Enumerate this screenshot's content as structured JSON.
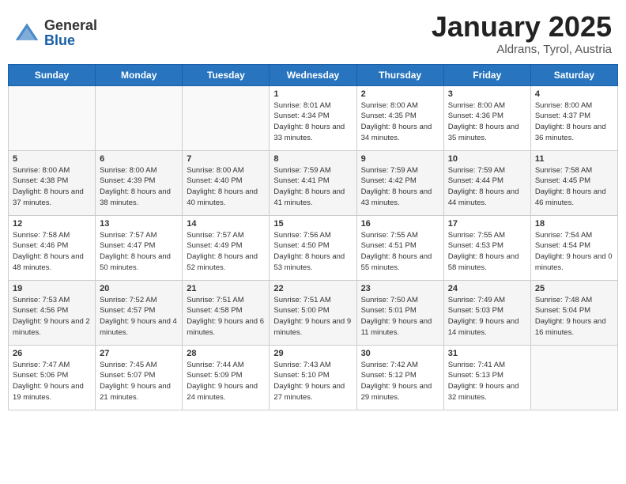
{
  "logo": {
    "general": "General",
    "blue": "Blue"
  },
  "title": "January 2025",
  "subtitle": "Aldrans, Tyrol, Austria",
  "days_of_week": [
    "Sunday",
    "Monday",
    "Tuesday",
    "Wednesday",
    "Thursday",
    "Friday",
    "Saturday"
  ],
  "weeks": [
    [
      {
        "num": "",
        "info": ""
      },
      {
        "num": "",
        "info": ""
      },
      {
        "num": "",
        "info": ""
      },
      {
        "num": "1",
        "info": "Sunrise: 8:01 AM\nSunset: 4:34 PM\nDaylight: 8 hours and 33 minutes."
      },
      {
        "num": "2",
        "info": "Sunrise: 8:00 AM\nSunset: 4:35 PM\nDaylight: 8 hours and 34 minutes."
      },
      {
        "num": "3",
        "info": "Sunrise: 8:00 AM\nSunset: 4:36 PM\nDaylight: 8 hours and 35 minutes."
      },
      {
        "num": "4",
        "info": "Sunrise: 8:00 AM\nSunset: 4:37 PM\nDaylight: 8 hours and 36 minutes."
      }
    ],
    [
      {
        "num": "5",
        "info": "Sunrise: 8:00 AM\nSunset: 4:38 PM\nDaylight: 8 hours and 37 minutes."
      },
      {
        "num": "6",
        "info": "Sunrise: 8:00 AM\nSunset: 4:39 PM\nDaylight: 8 hours and 38 minutes."
      },
      {
        "num": "7",
        "info": "Sunrise: 8:00 AM\nSunset: 4:40 PM\nDaylight: 8 hours and 40 minutes."
      },
      {
        "num": "8",
        "info": "Sunrise: 7:59 AM\nSunset: 4:41 PM\nDaylight: 8 hours and 41 minutes."
      },
      {
        "num": "9",
        "info": "Sunrise: 7:59 AM\nSunset: 4:42 PM\nDaylight: 8 hours and 43 minutes."
      },
      {
        "num": "10",
        "info": "Sunrise: 7:59 AM\nSunset: 4:44 PM\nDaylight: 8 hours and 44 minutes."
      },
      {
        "num": "11",
        "info": "Sunrise: 7:58 AM\nSunset: 4:45 PM\nDaylight: 8 hours and 46 minutes."
      }
    ],
    [
      {
        "num": "12",
        "info": "Sunrise: 7:58 AM\nSunset: 4:46 PM\nDaylight: 8 hours and 48 minutes."
      },
      {
        "num": "13",
        "info": "Sunrise: 7:57 AM\nSunset: 4:47 PM\nDaylight: 8 hours and 50 minutes."
      },
      {
        "num": "14",
        "info": "Sunrise: 7:57 AM\nSunset: 4:49 PM\nDaylight: 8 hours and 52 minutes."
      },
      {
        "num": "15",
        "info": "Sunrise: 7:56 AM\nSunset: 4:50 PM\nDaylight: 8 hours and 53 minutes."
      },
      {
        "num": "16",
        "info": "Sunrise: 7:55 AM\nSunset: 4:51 PM\nDaylight: 8 hours and 55 minutes."
      },
      {
        "num": "17",
        "info": "Sunrise: 7:55 AM\nSunset: 4:53 PM\nDaylight: 8 hours and 58 minutes."
      },
      {
        "num": "18",
        "info": "Sunrise: 7:54 AM\nSunset: 4:54 PM\nDaylight: 9 hours and 0 minutes."
      }
    ],
    [
      {
        "num": "19",
        "info": "Sunrise: 7:53 AM\nSunset: 4:56 PM\nDaylight: 9 hours and 2 minutes."
      },
      {
        "num": "20",
        "info": "Sunrise: 7:52 AM\nSunset: 4:57 PM\nDaylight: 9 hours and 4 minutes."
      },
      {
        "num": "21",
        "info": "Sunrise: 7:51 AM\nSunset: 4:58 PM\nDaylight: 9 hours and 6 minutes."
      },
      {
        "num": "22",
        "info": "Sunrise: 7:51 AM\nSunset: 5:00 PM\nDaylight: 9 hours and 9 minutes."
      },
      {
        "num": "23",
        "info": "Sunrise: 7:50 AM\nSunset: 5:01 PM\nDaylight: 9 hours and 11 minutes."
      },
      {
        "num": "24",
        "info": "Sunrise: 7:49 AM\nSunset: 5:03 PM\nDaylight: 9 hours and 14 minutes."
      },
      {
        "num": "25",
        "info": "Sunrise: 7:48 AM\nSunset: 5:04 PM\nDaylight: 9 hours and 16 minutes."
      }
    ],
    [
      {
        "num": "26",
        "info": "Sunrise: 7:47 AM\nSunset: 5:06 PM\nDaylight: 9 hours and 19 minutes."
      },
      {
        "num": "27",
        "info": "Sunrise: 7:45 AM\nSunset: 5:07 PM\nDaylight: 9 hours and 21 minutes."
      },
      {
        "num": "28",
        "info": "Sunrise: 7:44 AM\nSunset: 5:09 PM\nDaylight: 9 hours and 24 minutes."
      },
      {
        "num": "29",
        "info": "Sunrise: 7:43 AM\nSunset: 5:10 PM\nDaylight: 9 hours and 27 minutes."
      },
      {
        "num": "30",
        "info": "Sunrise: 7:42 AM\nSunset: 5:12 PM\nDaylight: 9 hours and 29 minutes."
      },
      {
        "num": "31",
        "info": "Sunrise: 7:41 AM\nSunset: 5:13 PM\nDaylight: 9 hours and 32 minutes."
      },
      {
        "num": "",
        "info": ""
      }
    ]
  ]
}
